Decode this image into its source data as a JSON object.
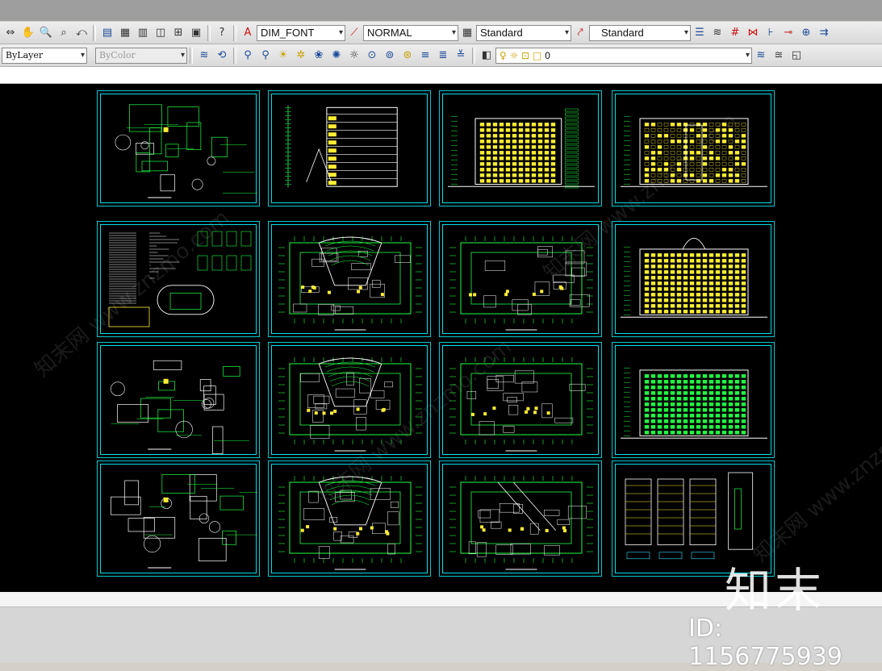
{
  "toolbar_top": {
    "text_style": "DIM_FONT",
    "dim_style": "NORMAL",
    "table_style": "Standard",
    "multileader_style": "Standard"
  },
  "toolbar_layers": {
    "linetype": "ByLayer",
    "color": "ByColor",
    "current_layer": "0"
  },
  "sheets": [
    {
      "row": 0,
      "col": 0,
      "kind": "detail"
    },
    {
      "row": 0,
      "col": 1,
      "kind": "section"
    },
    {
      "row": 0,
      "col": 2,
      "kind": "elevation-side"
    },
    {
      "row": 0,
      "col": 3,
      "kind": "elevation-front"
    },
    {
      "row": 1,
      "col": 0,
      "kind": "site-notes"
    },
    {
      "row": 1,
      "col": 1,
      "kind": "plan-auditorium"
    },
    {
      "row": 1,
      "col": 2,
      "kind": "plan"
    },
    {
      "row": 1,
      "col": 3,
      "kind": "elevation-yellow"
    },
    {
      "row": 2,
      "col": 0,
      "kind": "detail"
    },
    {
      "row": 2,
      "col": 1,
      "kind": "plan-auditorium"
    },
    {
      "row": 2,
      "col": 2,
      "kind": "plan"
    },
    {
      "row": 2,
      "col": 3,
      "kind": "elevation-green"
    },
    {
      "row": 3,
      "col": 0,
      "kind": "detail"
    },
    {
      "row": 3,
      "col": 1,
      "kind": "plan-auditorium"
    },
    {
      "row": 3,
      "col": 2,
      "kind": "plan-stair"
    },
    {
      "row": 3,
      "col": 3,
      "kind": "details-wall"
    }
  ],
  "watermark": {
    "logo": "知末",
    "id": "ID: 1156775939",
    "diagonal": "知末网 www.znzmo.com"
  }
}
